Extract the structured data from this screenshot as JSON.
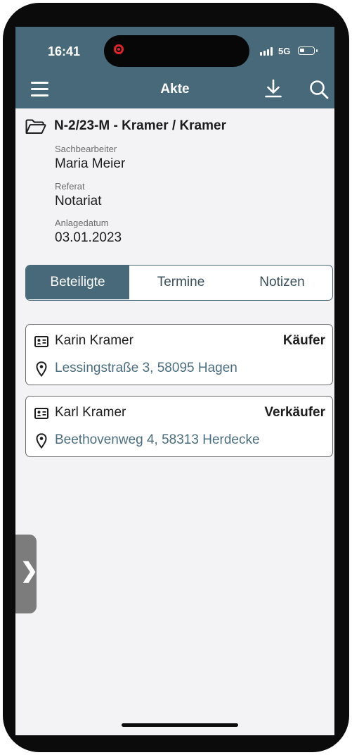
{
  "status_bar": {
    "time": "16:41",
    "network": "5G"
  },
  "nav": {
    "title": "Akte",
    "menu_icon": "menu-icon",
    "download_icon": "download-icon",
    "search_icon": "search-icon"
  },
  "case": {
    "title": "N-2/23-M - Kramer / Kramer",
    "fields": [
      {
        "label": "Sachbearbeiter",
        "value": "Maria Meier"
      },
      {
        "label": "Referat",
        "value": "Notariat"
      },
      {
        "label": "Anlagedatum",
        "value": "03.01.2023"
      }
    ]
  },
  "tabs": [
    {
      "label": "Beteiligte",
      "active": true
    },
    {
      "label": "Termine",
      "active": false
    },
    {
      "label": "Notizen",
      "active": false
    }
  ],
  "parties": [
    {
      "name": "Karin Kramer",
      "role": "Käufer",
      "address": "Lessingstraße 3, 58095 Hagen"
    },
    {
      "name": "Karl Kramer",
      "role": "Verkäufer",
      "address": "Beethovenweg 4, 58313 Herdecke"
    }
  ],
  "colors": {
    "header": "#48697a",
    "address": "#4b6e80",
    "background": "#f3f2f4"
  }
}
